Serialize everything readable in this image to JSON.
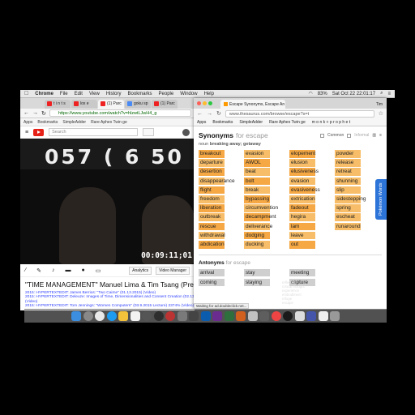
{
  "menubar": {
    "apple": "",
    "app": "Chrome",
    "items": [
      "File",
      "Edit",
      "View",
      "History",
      "Bookmarks",
      "People",
      "Window",
      "Help"
    ],
    "clock": "Sat Oct 22  22:01:17",
    "battery": "83%"
  },
  "youtube_window": {
    "tabs": [
      "t i n t s",
      "lox e",
      "(1) Parc",
      "goku sp",
      "(1) Parc"
    ],
    "url": "https://www.youtube.com/watch?v=hlzwtLJwH4_g",
    "bookmarks": [
      "Apps",
      "Bookmarks",
      "SimpleAdder",
      "Rare Aphex Twin ge",
      "m o n k + p r o p h e t"
    ],
    "search_placeholder": "Search",
    "video_big_text": "057  ( 6  50",
    "timecode": "00:09:11;01",
    "toolbar_buttons": [
      "Analytics",
      "Video Manager"
    ],
    "title": "\"TIME MANAGEMENT\" Manuel Lima & Tim Tsang (Presented by"
  },
  "links": [
    "2015: HYPERTEXTEDIT: James Berrios: \"Two Caime\" (01.13.2015) (Video)",
    "2015: HYPERTEXTEDIT: Deleuze: Images of Time, Dimensionalities and Consent Creation (02.13.2015) (Video)",
    "2015: HYPERTEXTEDIT: Tom Jennings: \"Women Computers\" (03.9.2015 Lecture) 2374% (Video)"
  ],
  "thesaurus_window": {
    "tab": "Escape Synonyms, Escape An",
    "user": "Tim",
    "url": "www.thesaurus.com/browse/escape?s=t",
    "bookmarks": [
      "Apps",
      "Bookmarks",
      "SimpleAdder",
      "Rare Aphex Twin ge",
      "m o n k + p r o p h e t"
    ],
    "synonyms_heading": "Synonyms",
    "synonyms_for": "for escape",
    "option_common": "Common",
    "option_informal": "Informal",
    "sense_label": "noun",
    "sense_text": "breaking away; getaway",
    "synonyms": [
      [
        "breakout",
        "evasion",
        "elopement",
        "powder"
      ],
      [
        "departure",
        "AWOL",
        "elusion",
        "release"
      ],
      [
        "desertion",
        "beat",
        "elusiveness",
        "retreat"
      ],
      [
        "disappearance",
        "bolt",
        "evasion",
        "shunning"
      ],
      [
        "flight",
        "break",
        "evasiveness",
        "slip"
      ],
      [
        "freedom",
        "bypassing",
        "extrication",
        "sidestepping"
      ],
      [
        "liberation",
        "circumvention",
        "fadeout",
        "spring"
      ],
      [
        "outbreak",
        "decampment",
        "hegira",
        "escheat"
      ],
      [
        "rescue",
        "deliverance",
        "lam",
        "runaround"
      ],
      [
        "withdrawal",
        "dodging",
        "leave",
        ""
      ],
      [
        "abdication",
        "ducking",
        "out",
        ""
      ]
    ],
    "antonyms_heading": "Antonyms",
    "antonyms_for": "for escape",
    "antonyms": [
      "arrival",
      "stay",
      "meeting",
      "coming",
      "staying",
      "capture"
    ],
    "pokemon_tab": "Pokémon Words",
    "status_text": "Waiting for ad.doubleclick.net..."
  },
  "side_list": [
    "reflection",
    "critical thought",
    "experience",
    "embodiment",
    "refuge",
    "escape"
  ]
}
